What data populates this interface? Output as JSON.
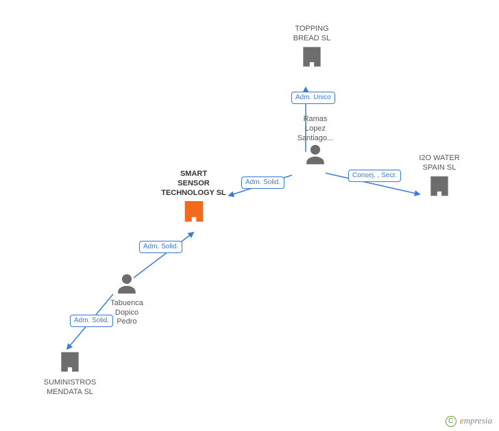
{
  "nodes": {
    "topping_bread": {
      "label": "TOPPING\nBREAD SL",
      "type": "company",
      "highlight": false
    },
    "ramas_lopez": {
      "label": "Ramas\nLopez\nSantiago...",
      "type": "person"
    },
    "smart_sensor": {
      "label": "SMART\nSENSOR\nTECHNOLOGY SL",
      "type": "company",
      "highlight": true
    },
    "i2o_water": {
      "label": "I2O WATER\nSPAIN SL",
      "type": "company",
      "highlight": false
    },
    "tabuenca": {
      "label": "Tabuenca\nDopico\nPedro",
      "type": "person"
    },
    "suministros": {
      "label": "SUMINISTROS\nMENDATA SL",
      "type": "company",
      "highlight": false
    }
  },
  "relations": {
    "adm_unico": "Adm.\nUnico",
    "adm_solid_1": "Adm.\nSolid.",
    "consej_secr": "Consej. ,\nSecr.",
    "adm_solid_2": "Adm.\nSolid.",
    "adm_solid_3": "Adm.\nSolid."
  },
  "footer": {
    "copyright_symbol": "C",
    "brand": "mpresia",
    "brand_e": "e"
  }
}
